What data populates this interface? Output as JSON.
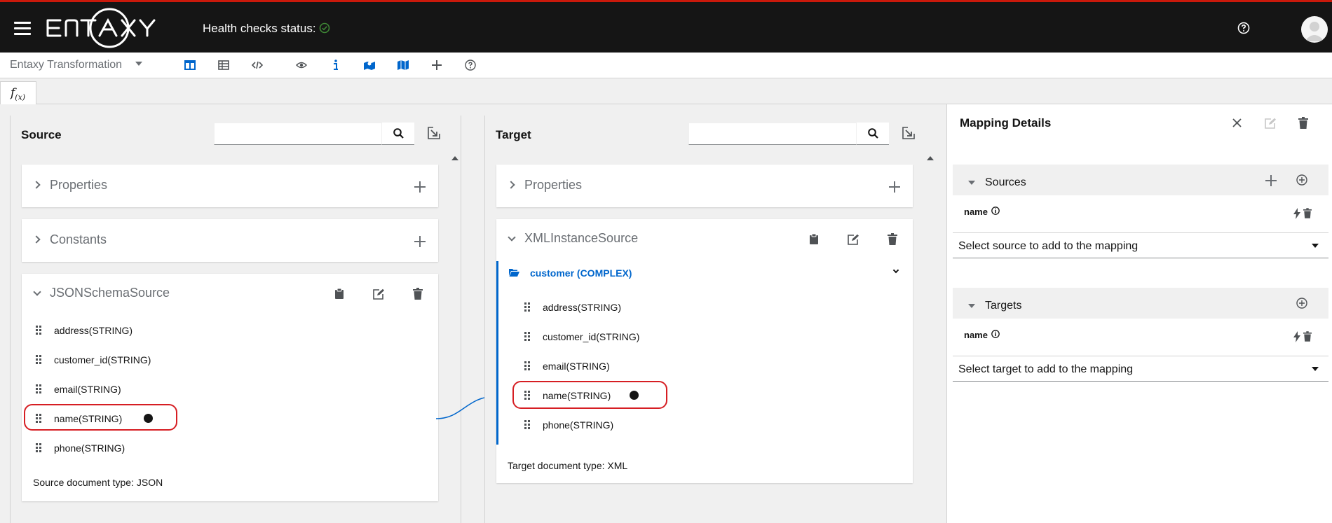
{
  "header": {
    "logo_text": "entaxy",
    "health_label": "Health checks status:",
    "health_status_color": "#3e8635"
  },
  "toolbar": {
    "mode": "Entaxy Transformation",
    "icons": [
      "columns-view-icon",
      "table-view-icon",
      "code-icon",
      "eye-icon",
      "info-icon",
      "mapped-fields-icon",
      "map-icon",
      "add-icon",
      "help-icon"
    ]
  },
  "fx_tab": {
    "label": "f",
    "sub": "(x)"
  },
  "source": {
    "title": "Source",
    "search_placeholder": "",
    "properties_label": "Properties",
    "constants_label": "Constants",
    "document_name": "JSONSchemaSource",
    "fields": [
      "address(STRING)",
      "customer_id(STRING)",
      "email(STRING)",
      "name(STRING)",
      "phone(STRING)"
    ],
    "doc_type": "Source document type: JSON"
  },
  "target": {
    "title": "Target",
    "search_placeholder": "",
    "properties_label": "Properties",
    "document_name": "XMLInstanceSource",
    "complex_label": "customer (COMPLEX)",
    "fields": [
      "address(STRING)",
      "customer_id(STRING)",
      "email(STRING)",
      "name(STRING)",
      "phone(STRING)"
    ],
    "doc_type": "Target document type: XML"
  },
  "details": {
    "title": "Mapping Details",
    "sources_label": "Sources",
    "source_field": "name",
    "source_select": "Select source to add to the mapping",
    "targets_label": "Targets",
    "target_field": "name",
    "target_select": "Select target to add to the mapping"
  },
  "colors": {
    "accent": "#0066cc",
    "selection": "#d61e23",
    "masthead": "#151515"
  }
}
